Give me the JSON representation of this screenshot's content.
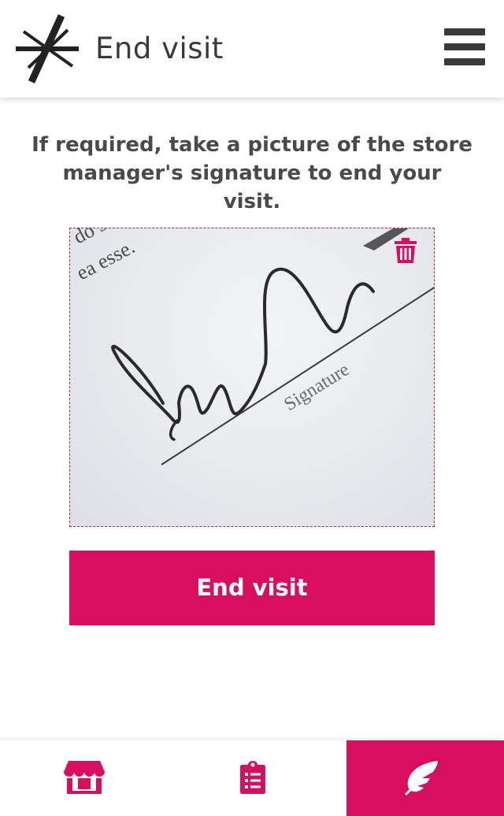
{
  "header": {
    "title": "End visit",
    "logo_icon": "x-star-logo",
    "menu_icon": "hamburger-menu-icon"
  },
  "main": {
    "instruction": "If required, take a picture of the store manager's signature to end your visit.",
    "photo": {
      "description_icon": "signature-photo",
      "paper_text_1": "do s",
      "paper_text_2": "ea esse.",
      "signature_label": "Signature",
      "delete_icon": "trash-icon"
    },
    "end_button_label": "End visit"
  },
  "bottom_nav": {
    "items": [
      {
        "icon": "store-icon",
        "active": false
      },
      {
        "icon": "clipboard-list-icon",
        "active": false
      },
      {
        "icon": "feather-icon",
        "active": true
      }
    ]
  },
  "colors": {
    "accent": "#d80f61",
    "text": "#3a3a3a",
    "background": "#ffffff"
  }
}
